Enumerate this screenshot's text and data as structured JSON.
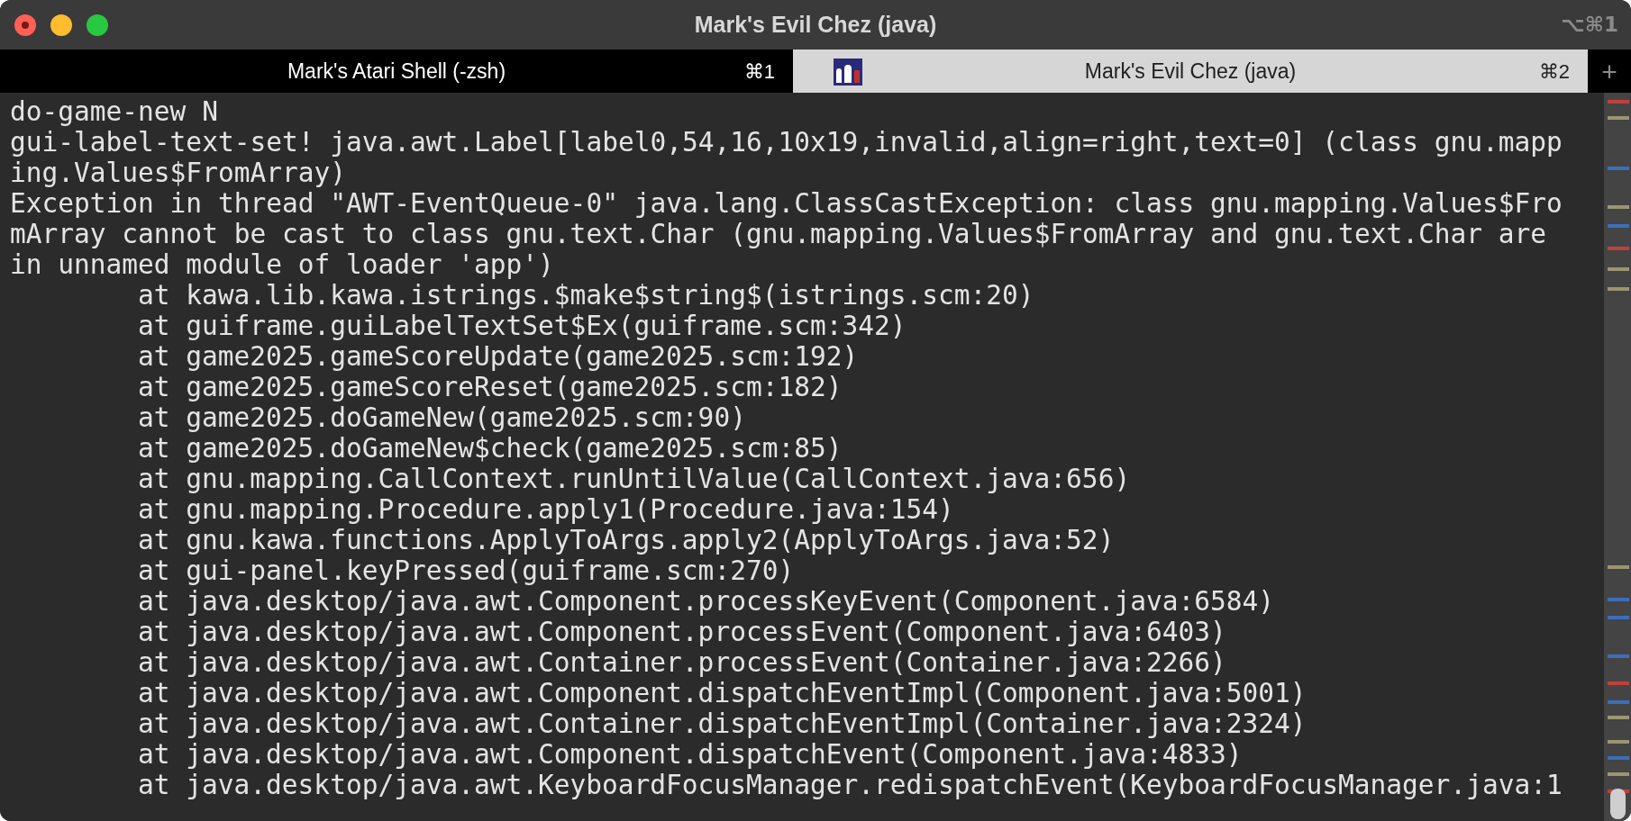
{
  "window": {
    "title": "Mark's Evil Chez (java)",
    "shortcut": "⌥⌘1"
  },
  "tabs": [
    {
      "label": "Mark's Atari Shell (-zsh)",
      "shortcut": "⌘1",
      "selected": false,
      "has_thumbnail": false
    },
    {
      "label": "Mark's Evil Chez (java)",
      "shortcut": "⌘2",
      "selected": true,
      "has_thumbnail": true
    }
  ],
  "new_tab": "+",
  "lines": [
    {
      "kind": "plain",
      "text": "do-game-new N"
    },
    {
      "kind": "plain",
      "text": "gui-label-text-set! java.awt.Label[label0,54,16,10x19,invalid,align=right,text=0] (class gnu.mapp"
    },
    {
      "kind": "plain",
      "text": "ing.Values$FromArray)"
    },
    {
      "kind": "plain",
      "text": "Exception in thread \"AWT-EventQueue-0\" java.lang.ClassCastException: class gnu.mapping.Values$Fro"
    },
    {
      "kind": "plain",
      "text": "mArray cannot be cast to class gnu.text.Char (gnu.mapping.Values$FromArray and gnu.text.Char are"
    },
    {
      "kind": "plain",
      "text": "in unnamed module of loader 'app')"
    },
    {
      "kind": "trace",
      "text": "at kawa.lib.kawa.istrings.$make$string$(istrings.scm:20)"
    },
    {
      "kind": "trace",
      "text": "at guiframe.guiLabelTextSet$Ex(guiframe.scm:342)"
    },
    {
      "kind": "trace",
      "text": "at game2025.gameScoreUpdate(game2025.scm:192)"
    },
    {
      "kind": "trace",
      "text": "at game2025.gameScoreReset(game2025.scm:182)"
    },
    {
      "kind": "trace",
      "text": "at game2025.doGameNew(game2025.scm:90)"
    },
    {
      "kind": "trace",
      "text": "at game2025.doGameNew$check(game2025.scm:85)"
    },
    {
      "kind": "trace",
      "text": "at gnu.mapping.CallContext.runUntilValue(CallContext.java:656)"
    },
    {
      "kind": "trace",
      "text": "at gnu.mapping.Procedure.apply1(Procedure.java:154)"
    },
    {
      "kind": "trace",
      "text": "at gnu.kawa.functions.ApplyToArgs.apply2(ApplyToArgs.java:52)"
    },
    {
      "kind": "trace",
      "text": "at gui-panel.keyPressed(guiframe.scm:270)"
    },
    {
      "kind": "trace",
      "text": "at java.desktop/java.awt.Component.processKeyEvent(Component.java:6584)"
    },
    {
      "kind": "trace",
      "text": "at java.desktop/java.awt.Component.processEvent(Component.java:6403)"
    },
    {
      "kind": "trace",
      "text": "at java.desktop/java.awt.Container.processEvent(Container.java:2266)"
    },
    {
      "kind": "trace",
      "text": "at java.desktop/java.awt.Component.dispatchEventImpl(Component.java:5001)"
    },
    {
      "kind": "trace",
      "text": "at java.desktop/java.awt.Container.dispatchEventImpl(Container.java:2324)"
    },
    {
      "kind": "trace",
      "text": "at java.desktop/java.awt.Component.dispatchEvent(Component.java:4833)"
    },
    {
      "kind": "trace",
      "text": "at java.desktop/java.awt.KeyboardFocusManager.redispatchEvent(KeyboardFocusManager.java:1"
    }
  ]
}
